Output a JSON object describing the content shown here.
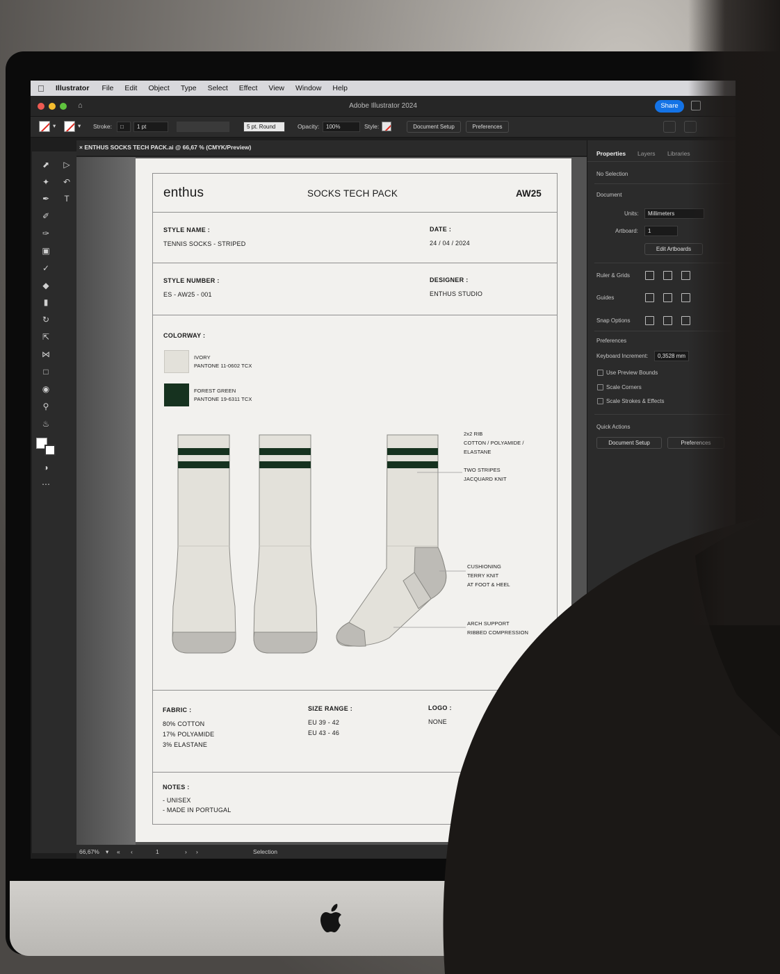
{
  "menubar": {
    "items": [
      "Illustrator",
      "File",
      "Edit",
      "Object",
      "Type",
      "Select",
      "Effect",
      "View",
      "Window",
      "Help"
    ]
  },
  "titlebar": {
    "title": "Adobe Illustrator 2024",
    "share_label": "Share"
  },
  "controlbar": {
    "stroke_label": "Stroke:",
    "stroke_weight": "1 pt",
    "brush": "5 pt. Round",
    "opacity_label": "Opacity:",
    "opacity_value": "100%",
    "style_label": "Style:",
    "document_setup": "Document Setup",
    "preferences": "Preferences"
  },
  "tab": {
    "label": "ENTHUS SOCKS TECH PACK.ai @ 66,67 % (CMYK/Preview)"
  },
  "document": {
    "brand": "enthus",
    "title": "SOCKS TECH PACK",
    "season": "AW25",
    "style_name_label": "STYLE NAME :",
    "style_name": "TENNIS SOCKS - STRIPED",
    "date_label": "DATE :",
    "date": "24 / 04 / 2024",
    "style_number_label": "STYLE NUMBER :",
    "style_number": "ES - AW25 - 001",
    "designer_label": "DESIGNER :",
    "designer": "ENTHUS STUDIO",
    "colorway_label": "COLORWAY :",
    "colorways": [
      {
        "name": "IVORY",
        "pantone": "PANTONE 11-0602 TCX",
        "color": "#e3e1da"
      },
      {
        "name": "FOREST GREEN",
        "pantone": "PANTONE 19-6311 TCX",
        "color": "#16321f"
      }
    ],
    "callouts": [
      {
        "line1": "2x2 RIB",
        "line2": "COTTON / POLYAMIDE /",
        "line3": "ELASTANE"
      },
      {
        "line1": "TWO STRIPES",
        "line2": "JACQUARD KNIT"
      },
      {
        "line1": "CUSHIONING",
        "line2": "TERRY KNIT",
        "line3": "AT FOOT & HEEL"
      },
      {
        "line1": "ARCH SUPPORT",
        "line2": "RIBBED COMPRESSION"
      }
    ],
    "fabric_label": "FABRIC :",
    "fabric": [
      "80% COTTON",
      "17% POLYAMIDE",
      "3% ELASTANE"
    ],
    "size_label": "SIZE RANGE :",
    "sizes": [
      "EU 39 - 42",
      "EU 43 - 46"
    ],
    "logo_label": "LOGO :",
    "logo": "NONE",
    "notes_label": "NOTES :",
    "notes": [
      "- UNISEX",
      "- MADE IN PORTUGAL"
    ]
  },
  "statusbar": {
    "zoom": "66,67%",
    "artboard": "1",
    "tool": "Selection"
  },
  "panel": {
    "tabs": [
      "Properties",
      "Layers",
      "Libraries"
    ],
    "no_selection": "No Selection",
    "document_label": "Document",
    "units_label": "Units:",
    "units_value": "Millimeters",
    "artboard_label": "Artboard:",
    "artboard_value": "1",
    "edit_artboards": "Edit Artboards",
    "ruler_grids": "Ruler & Grids",
    "guides": "Guides",
    "snap_options": "Snap Options",
    "preferences_label": "Preferences",
    "keyboard_increment_label": "Keyboard Increment:",
    "keyboard_increment_value": "0,3528 mm",
    "use_preview_bounds": "Use Preview Bounds",
    "scale_corners": "Scale Corners",
    "scale_strokes": "Scale Strokes & Effects",
    "quick_actions": "Quick Actions",
    "document_setup": "Document Setup",
    "preferences_btn": "Preferences"
  },
  "colors": {
    "accent": "#1473e6",
    "ivory": "#e3e1da",
    "forest_green": "#16321f"
  }
}
